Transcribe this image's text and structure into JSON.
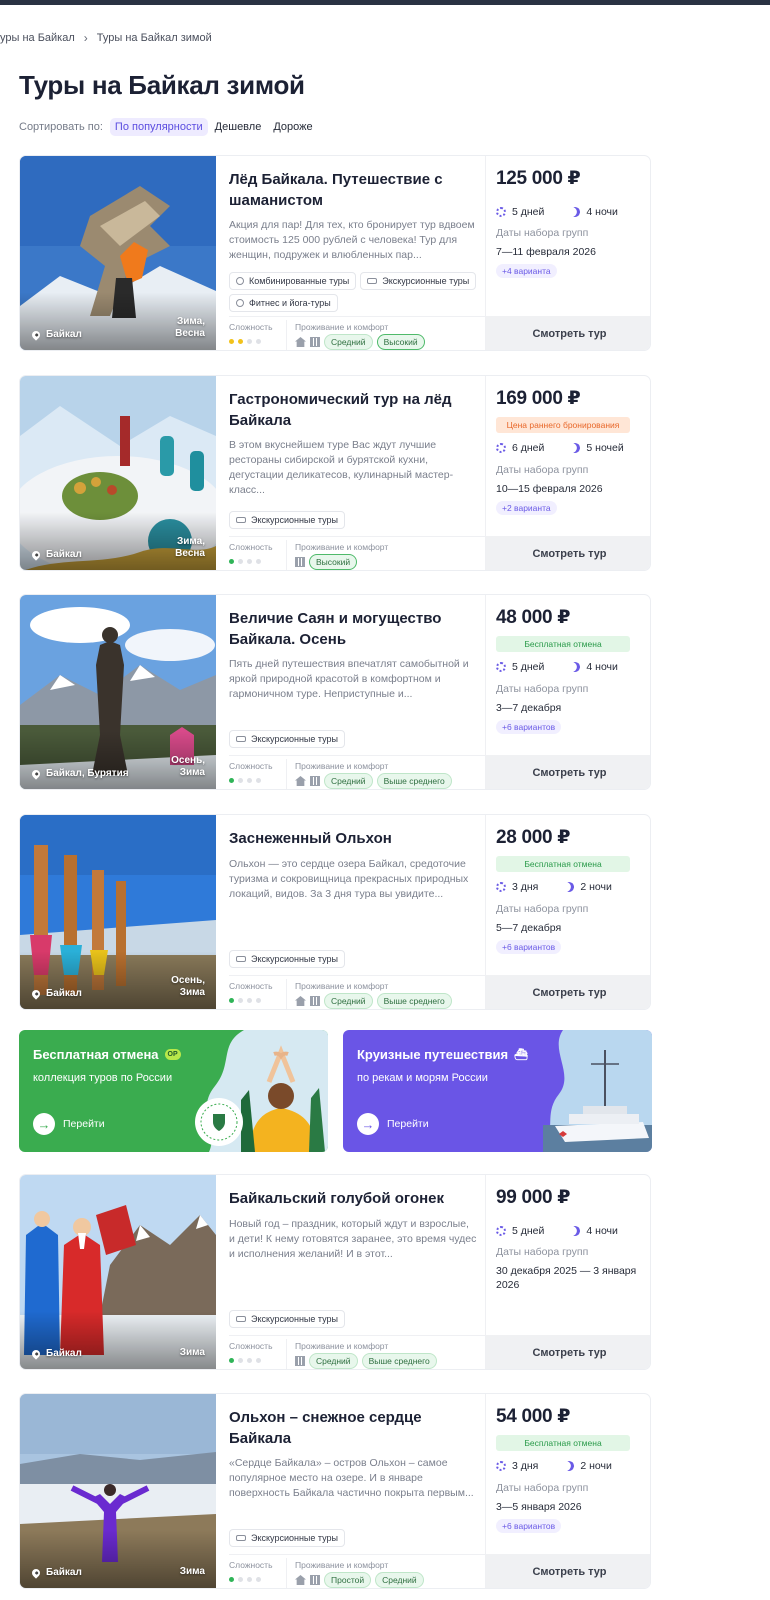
{
  "breadcrumb": [
    "уры на Байкал",
    "Туры на Байкал зимой"
  ],
  "page_title": "Туры на Байкал зимой",
  "sort": {
    "label": "Сортировать по:",
    "options": [
      "По популярности",
      "Дешевле",
      "Дороже"
    ],
    "active": "По популярности"
  },
  "common": {
    "difficulty_label": "Сложность",
    "comfort_label": "Проживание и комфорт",
    "dates_label": "Даты набора групп",
    "cta_label": "Смотреть тур"
  },
  "tours": [
    {
      "title": "Лёд Байкала. Путешествие с шаманистом",
      "desc": "Акция для пар! Для тех, кто бронирует тур вдвоем стоимость 125 000 рублей с человека! Тур для женщин, подружек и влюбленных пар...",
      "tags": [
        "Комбинированные туры",
        "Экскурсионные туры",
        "Фитнес и йога-туры"
      ],
      "location": "Байкал",
      "season": [
        "Зима,",
        "Весна"
      ],
      "price": "125 000 ₽",
      "pill": "",
      "days": "5 дней",
      "nights": "4 ночи",
      "dates": "7—11 февраля 2026",
      "variants": "+4 варианта",
      "difficulty": 2,
      "difficulty_color": "yellow",
      "comfort_icons": [
        "house",
        "building"
      ],
      "comfort": [
        "Средний",
        "Высокий"
      ]
    },
    {
      "title": "Гастрономический тур на лёд Байкала",
      "desc": "В этом вкуснейшем туре Вас ждут лучшие рестораны сибирской и бурятской кухни, дегустации деликатесов, кулинарный мастер-класс...",
      "tags": [
        "Экскурсионные туры"
      ],
      "location": "Байкал",
      "season": [
        "Зима,",
        "Весна"
      ],
      "price": "169 000 ₽",
      "pill": "Цена раннего бронирования",
      "days": "6 дней",
      "nights": "5 ночей",
      "dates": "10—15 февраля 2026",
      "variants": "+2 варианта",
      "difficulty": 1,
      "difficulty_color": "green",
      "comfort_icons": [
        "building"
      ],
      "comfort": [
        "Высокий"
      ]
    },
    {
      "title": "Величие Саян и могущество Байкала. Осень",
      "desc": "Пять дней путешествия впечатлят самобытной и яркой природной красотой в комфортном и гармоничном туре.  Неприступные и...",
      "tags": [
        "Экскурсионные туры"
      ],
      "location": "Байкал, Бурятия",
      "season": [
        "Осень,",
        "Зима"
      ],
      "price": "48 000 ₽",
      "pill": "Бесплатная отмена",
      "days": "5 дней",
      "nights": "4 ночи",
      "dates": "3—7 декабря",
      "variants": "+6 вариантов",
      "difficulty": 1,
      "difficulty_color": "green",
      "comfort_icons": [
        "house",
        "building"
      ],
      "comfort": [
        "Средний",
        "Выше среднего"
      ]
    },
    {
      "title": "Заснеженный Ольхон",
      "desc": "Ольхон — это сердце озера Байкал, средоточие туризма и сокровищница прекрасных природных локаций, видов.  За 3 дня тура вы увидите...",
      "tags": [
        "Экскурсионные туры"
      ],
      "location": "Байкал",
      "season": [
        "Осень,",
        "Зима"
      ],
      "price": "28 000 ₽",
      "pill": "Бесплатная отмена",
      "days": "3 дня",
      "nights": "2 ночи",
      "dates": "5—7 декабря",
      "variants": "+6 вариантов",
      "difficulty": 1,
      "difficulty_color": "green",
      "comfort_icons": [
        "house",
        "building"
      ],
      "comfort": [
        "Средний",
        "Выше среднего"
      ]
    },
    {
      "title": "Байкальский голубой огонек",
      "desc": "Новый год – праздник, который ждут и взрослые, и дети! К нему готовятся заранее, это время чудес и исполнения желаний! И в этот...",
      "tags": [
        "Экскурсионные туры"
      ],
      "location": "Байкал",
      "season": [
        "Зима"
      ],
      "price": "99 000 ₽",
      "pill": "",
      "days": "5 дней",
      "nights": "4 ночи",
      "dates": "30 декабря 2025 — 3 января 2026",
      "variants": "",
      "difficulty": 1,
      "difficulty_color": "green",
      "comfort_icons": [
        "building"
      ],
      "comfort": [
        "Средний",
        "Выше среднего"
      ]
    },
    {
      "title": "Ольхон – снежное сердце Байкала",
      "desc": "«Сердце Байкала» – остров Ольхон – самое популярное место на озере. И в январе поверхность Байкала частично покрыта первым...",
      "tags": [
        "Экскурсионные туры"
      ],
      "location": "Байкал",
      "season": [
        "Зима"
      ],
      "price": "54 000 ₽",
      "pill": "Бесплатная отмена",
      "days": "3 дня",
      "nights": "2 ночи",
      "dates": "3—5 января 2026",
      "variants": "+6 вариантов",
      "difficulty": 1,
      "difficulty_color": "green",
      "comfort_icons": [
        "house",
        "building"
      ],
      "comfort": [
        "Простой",
        "Средний"
      ]
    }
  ],
  "promos": [
    {
      "title": "Бесплатная отмена",
      "badge": "OP",
      "subtitle": "коллекция туров по России",
      "cta": "Перейти",
      "color": "#3aac4f"
    },
    {
      "title": "Круизные путешествия",
      "badge": "",
      "subtitle": "по рекам и морям России",
      "cta": "Перейти",
      "color": "#6a55e6"
    }
  ]
}
